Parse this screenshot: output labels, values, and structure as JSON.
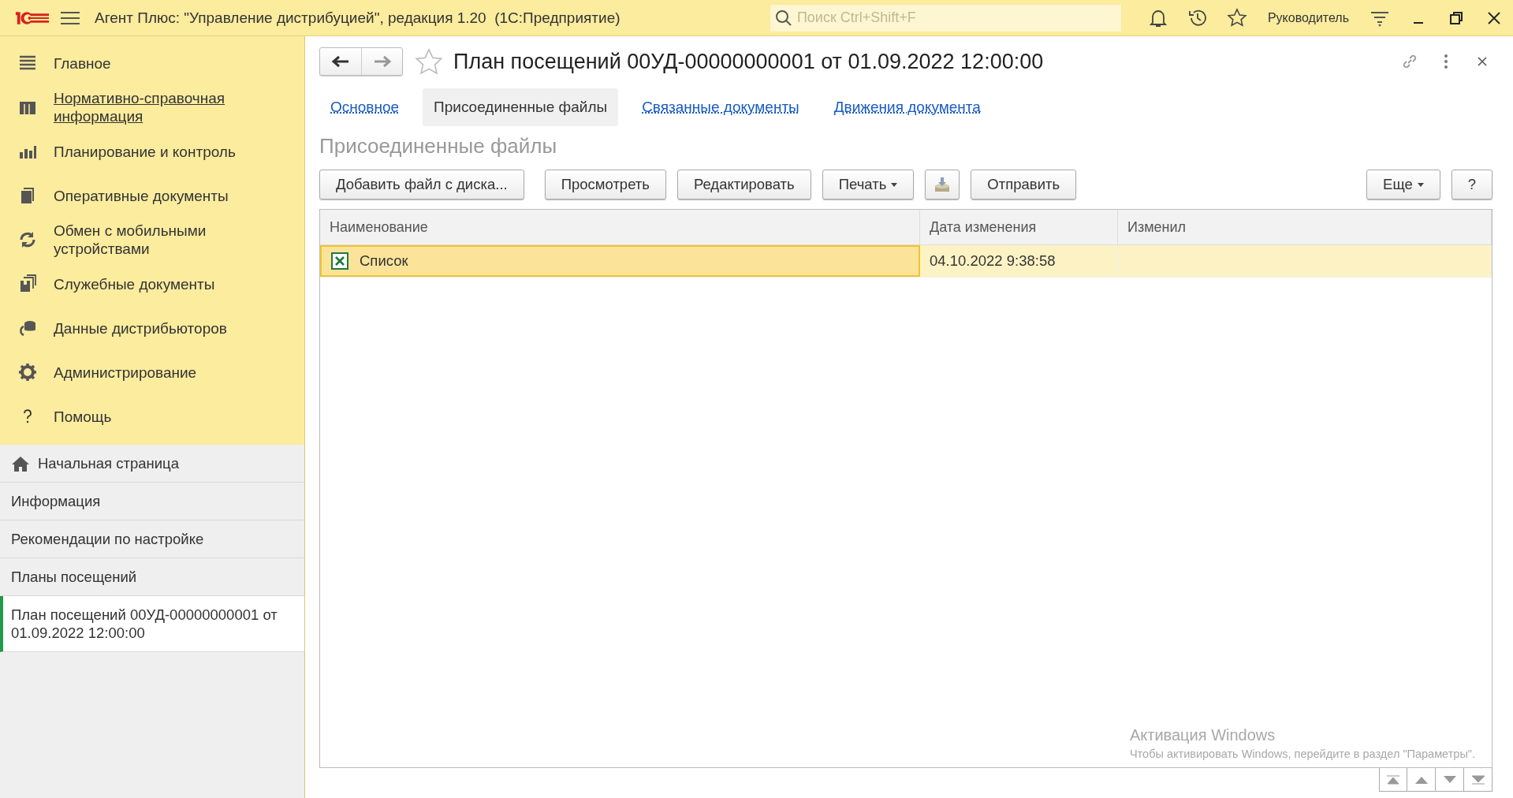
{
  "window": {
    "title": "Агент Плюс: \"Управление дистрибуцией\", редакция 1.20  (1С:Предприятие)",
    "search": {
      "placeholder": "Поиск Ctrl+Shift+F"
    },
    "user": "Руководитель"
  },
  "sidebar": {
    "sections": [
      {
        "label": "Главное",
        "link": false
      },
      {
        "label": "Нормативно-справочная информация",
        "link": true
      },
      {
        "label": "Планирование и контроль",
        "link": false
      },
      {
        "label": "Оперативные документы",
        "link": false
      },
      {
        "label": "Обмен с мобильными устройствами",
        "link": false
      },
      {
        "label": "Служебные документы",
        "link": false
      },
      {
        "label": "Данные дистрибьюторов",
        "link": false
      },
      {
        "label": "Администрирование",
        "link": false
      },
      {
        "label": "Помощь",
        "link": false
      }
    ],
    "open_windows": [
      {
        "label": "Начальная страница",
        "selected": false
      },
      {
        "label": "Информация",
        "selected": false
      },
      {
        "label": "Рекомендации по настройке",
        "selected": false
      },
      {
        "label": "Планы посещений",
        "selected": false
      },
      {
        "label": "План посещений 00УД-00000000001 от 01.09.2022 12:00:00",
        "selected": true
      }
    ]
  },
  "document": {
    "title": "План посещений 00УД-00000000001 от 01.09.2022 12:00:00",
    "tabs": [
      {
        "label": "Основное",
        "selected": false
      },
      {
        "label": "Присоединенные файлы",
        "selected": true
      },
      {
        "label": "Связанные документы",
        "selected": false
      },
      {
        "label": "Движения документа",
        "selected": false
      }
    ],
    "section_title": "Присоединенные файлы",
    "toolbar": [
      {
        "kind": "text",
        "label": "Добавить файл с диска..."
      },
      {
        "kind": "text",
        "label": "Просмотреть"
      },
      {
        "kind": "text",
        "label": "Редактировать"
      },
      {
        "kind": "menu",
        "label": "Печать"
      },
      {
        "kind": "icon"
      },
      {
        "kind": "text",
        "label": "Отправить"
      }
    ],
    "toolbar_right": [
      {
        "kind": "menu",
        "label": "Еще"
      },
      {
        "kind": "text",
        "label": "?"
      }
    ],
    "table": {
      "columns": [
        "Наименование",
        "Дата изменения",
        "Изменил"
      ],
      "rows": [
        {
          "name": "Список",
          "date": "04.10.2022 9:38:58",
          "selected": true
        }
      ]
    }
  },
  "os_notice": {
    "title": "Активация Windows",
    "text": "Чтобы активировать Windows, перейдите в раздел \"Параметры\"."
  }
}
